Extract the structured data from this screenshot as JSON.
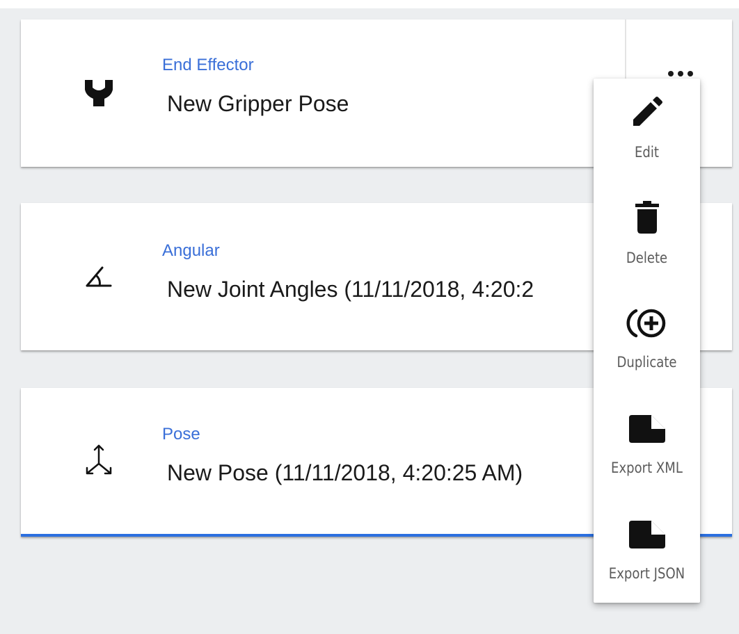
{
  "cards": [
    {
      "type": "End Effector",
      "name": "New Gripper Pose",
      "icon": "gripper-icon"
    },
    {
      "type": "Angular",
      "name": "New Joint Angles (11/11/2018, 4:20:2",
      "icon": "angle-icon"
    },
    {
      "type": "Pose",
      "name": "New Pose (11/11/2018, 4:20:25 AM)",
      "icon": "pose-axes-icon",
      "selected": true
    }
  ],
  "menu": {
    "items": [
      {
        "label": "Edit",
        "icon": "pencil-icon"
      },
      {
        "label": "Delete",
        "icon": "trash-icon"
      },
      {
        "label": "Duplicate",
        "icon": "duplicate-icon"
      },
      {
        "label": "Export XML",
        "icon": "file-icon"
      },
      {
        "label": "Export JSON",
        "icon": "file-icon"
      }
    ]
  },
  "colors": {
    "accent": "#2b6fe0",
    "type_label": "#3a6fd8",
    "background": "#eceef0"
  }
}
